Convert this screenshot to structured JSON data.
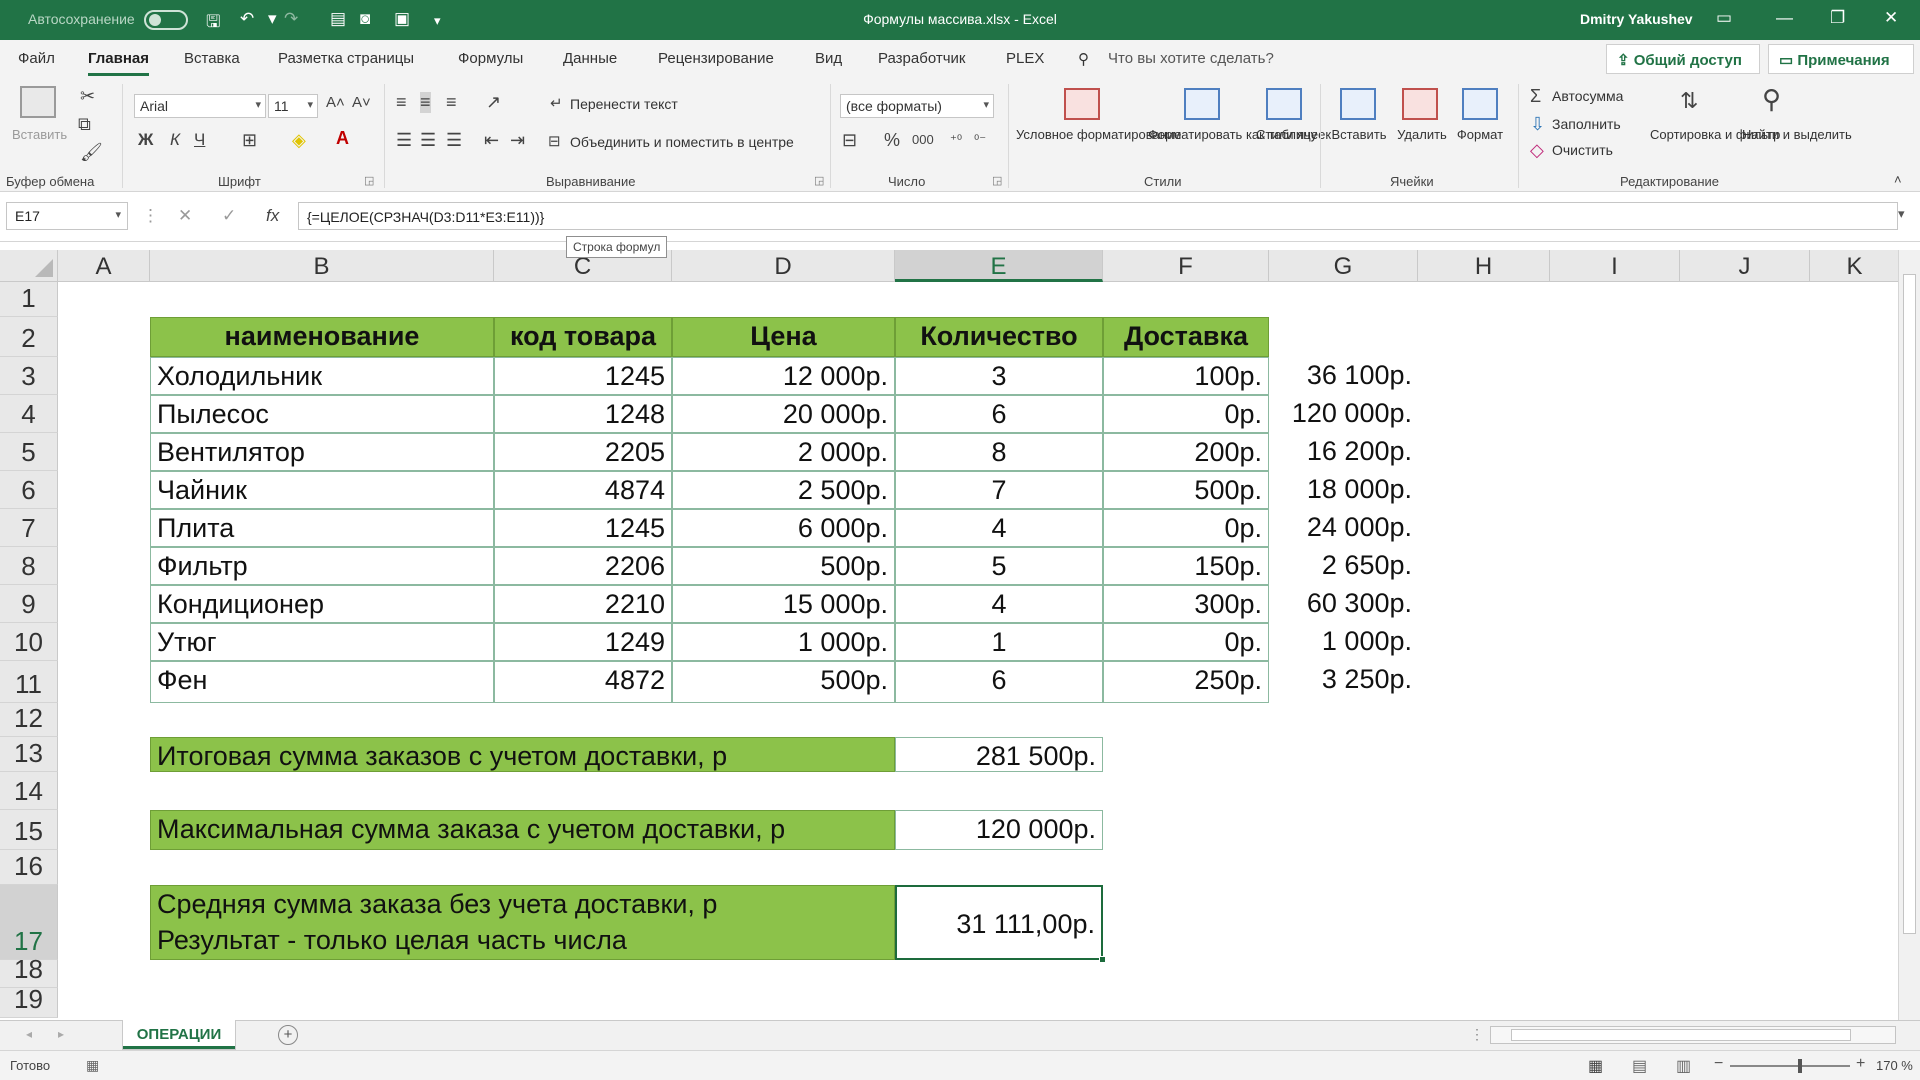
{
  "titlebar": {
    "autosave": "Автосохранение",
    "document_title": "Формулы массива.xlsx  -  Excel",
    "user": "Dmitry Yakushev"
  },
  "tabs": [
    "Файл",
    "Главная",
    "Вставка",
    "Разметка страницы",
    "Формулы",
    "Данные",
    "Рецензирование",
    "Вид",
    "Разработчик",
    "PLEX"
  ],
  "active_tab": "Главная",
  "tell_me": "Что вы хотите сделать?",
  "share_label": "Общий доступ",
  "notes_label": "Примечания",
  "ribbon": {
    "clipboard": {
      "paste": "Вставить",
      "label": "Буфер обмена"
    },
    "font": {
      "name": "Arial",
      "size": "11",
      "label": "Шрифт",
      "bold": "Ж",
      "italic": "К",
      "underline": "Ч"
    },
    "alignment": {
      "wrap": "Перенести текст",
      "merge": "Объединить и поместить в центре",
      "label": "Выравнивание"
    },
    "number": {
      "format": "(все форматы)",
      "label": "Число"
    },
    "styles": {
      "conditional": "Условное форматирование",
      "as_table": "Форматировать как таблицу",
      "cell_styles": "Стили ячеек",
      "label": "Стили"
    },
    "cells": {
      "insert": "Вставить",
      "delete": "Удалить",
      "format": "Формат",
      "label": "Ячейки"
    },
    "editing": {
      "autosum": "Автосумма",
      "fill": "Заполнить",
      "clear": "Очистить",
      "sort": "Сортировка и фильтр",
      "find": "Найти и выделить",
      "label": "Редактирование"
    }
  },
  "formula_bar": {
    "name_box": "E17",
    "formula": "{=ЦЕЛОЕ(СРЗНАЧ(D3:D11*E3:E11))}",
    "tooltip": "Строка формул"
  },
  "columns": [
    "A",
    "B",
    "C",
    "D",
    "E",
    "F",
    "G",
    "H",
    "I",
    "J",
    "K"
  ],
  "selected_column": "E",
  "rows": [
    "1",
    "2",
    "3",
    "4",
    "5",
    "6",
    "7",
    "8",
    "9",
    "10",
    "11",
    "12",
    "13",
    "14",
    "15",
    "16",
    "17",
    "18",
    "19"
  ],
  "selected_row": "17",
  "table": {
    "headers": [
      "наименование",
      "код товара",
      "Цена",
      "Количество",
      "Доставка"
    ],
    "rows": [
      {
        "name": "Холодильник",
        "code": "1245",
        "price": "12 000р.",
        "qty": "3",
        "delivery": "100р.",
        "total": "36 100р."
      },
      {
        "name": "Пылесос",
        "code": "1248",
        "price": "20 000р.",
        "qty": "6",
        "delivery": "0р.",
        "total": "120 000р."
      },
      {
        "name": "Вентилятор",
        "code": "2205",
        "price": "2 000р.",
        "qty": "8",
        "delivery": "200р.",
        "total": "16 200р."
      },
      {
        "name": "Чайник",
        "code": "4874",
        "price": "2 500р.",
        "qty": "7",
        "delivery": "500р.",
        "total": "18 000р."
      },
      {
        "name": "Плита",
        "code": "1245",
        "price": "6 000р.",
        "qty": "4",
        "delivery": "0р.",
        "total": "24 000р."
      },
      {
        "name": "Фильтр",
        "code": "2206",
        "price": "500р.",
        "qty": "5",
        "delivery": "150р.",
        "total": "2 650р."
      },
      {
        "name": "Кондиционер",
        "code": "2210",
        "price": "15 000р.",
        "qty": "4",
        "delivery": "300р.",
        "total": "60 300р."
      },
      {
        "name": "Утюг",
        "code": "1249",
        "price": "1 000р.",
        "qty": "1",
        "delivery": "0р.",
        "total": "1 000р."
      },
      {
        "name": "Фен",
        "code": "4872",
        "price": "500р.",
        "qty": "6",
        "delivery": "250р.",
        "total": "3 250р."
      }
    ]
  },
  "summary": {
    "total_label": "Итоговая сумма заказов с учетом доставки, р",
    "total_value": "281 500р.",
    "max_label": "Максимальная сумма заказа с учетом доставки, р",
    "max_value": "120 000р.",
    "avg_label_line1": "Средняя сумма заказа без учета доставки, р",
    "avg_label_line2": "Результат - только целая часть числа",
    "avg_value": "31 111,00р."
  },
  "sheet_tab": "ОПЕРАЦИИ",
  "status": {
    "ready": "Готово",
    "zoom": "170 %"
  },
  "colors": {
    "excel_green": "#217346",
    "header_fill": "#8cc24a"
  }
}
